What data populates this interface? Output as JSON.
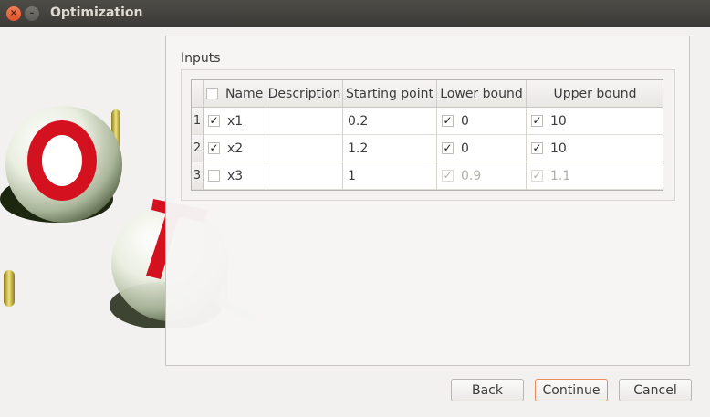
{
  "window": {
    "title": "Optimization",
    "close_glyph": "×",
    "min_glyph": "–"
  },
  "group": {
    "title": "Inputs"
  },
  "table": {
    "headers": [
      "Name",
      "Description",
      "Starting point",
      "Lower bound",
      "Upper bound"
    ],
    "rows": [
      {
        "num": "1",
        "selected": true,
        "name": "x1",
        "description": "",
        "start": "0.2",
        "lower_checked": true,
        "lower": "0",
        "upper_checked": true,
        "upper": "10",
        "enabled": true
      },
      {
        "num": "2",
        "selected": true,
        "name": "x2",
        "description": "",
        "start": "1.2",
        "lower_checked": true,
        "lower": "0",
        "upper_checked": true,
        "upper": "10",
        "enabled": true
      },
      {
        "num": "3",
        "selected": false,
        "name": "x3",
        "description": "",
        "start": "1",
        "lower_checked": true,
        "lower": "0.9",
        "upper_checked": true,
        "upper": "1.1",
        "enabled": false
      }
    ]
  },
  "buttons": {
    "back": "Back",
    "continue": "Continue",
    "cancel": "Cancel"
  },
  "colors": {
    "accent": "#e98b5d",
    "titlebar": "#3b3a36",
    "logo_red": "#d4121f"
  }
}
